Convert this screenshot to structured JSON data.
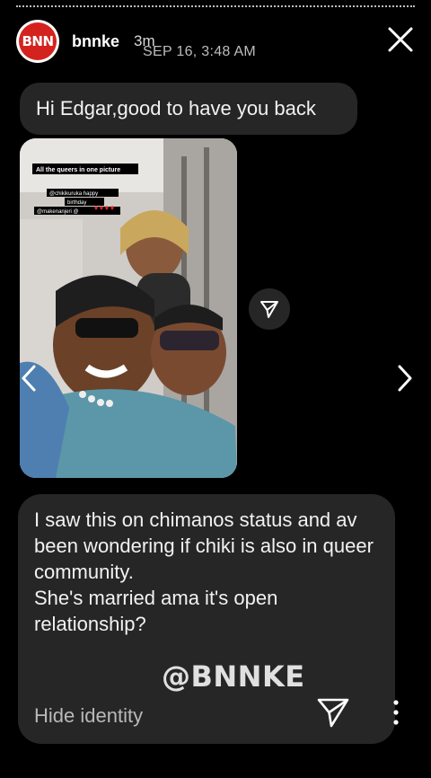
{
  "header": {
    "avatar_text": "BNN",
    "username": "bnnke",
    "time_ago": "3m",
    "date": "SEP 16, 3:48 AM",
    "close_icon": "close-icon"
  },
  "messages": {
    "greeting": "Hi Edgar,good to have you back",
    "body": "I saw this on chimanos status and av been wondering if chiki is also in queer community.\nShe's married ama it's open relationship?"
  },
  "photo": {
    "caption_line1": "All the queers in one picture",
    "tag1": "@chikikuruka happy",
    "tag2": "birthday",
    "tag3": "@makenanjeri @"
  },
  "footer": {
    "watermark": "@BNNKE",
    "hide_identity": "Hide identity"
  },
  "colors": {
    "background": "#000000",
    "bubble": "#262626",
    "brand_red": "#d4231f"
  }
}
